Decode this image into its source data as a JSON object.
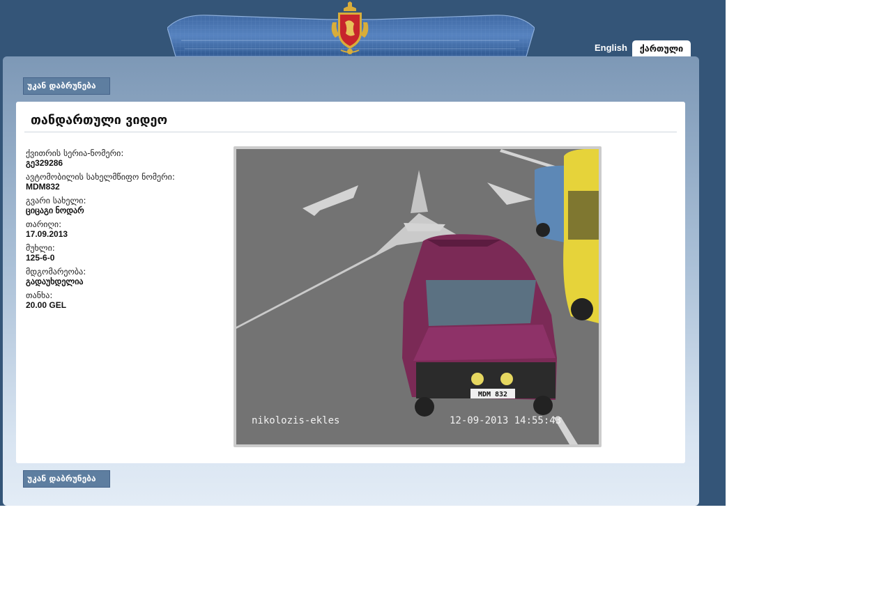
{
  "header": {
    "languages": [
      {
        "label": "English",
        "active": false
      },
      {
        "label": "ქართული",
        "active": true
      }
    ],
    "colors": {
      "background": "#345578",
      "banner": "#4a75b0",
      "emblem_red": "#c7252c",
      "emblem_gold": "#d9ad3a"
    }
  },
  "navigation": {
    "back_label": "უკან დაბრუნება"
  },
  "content": {
    "title": "თანდართული ვიდეო",
    "fields": [
      {
        "label": "ქვითრის სერია-ნომერი:",
        "value": "გე329286"
      },
      {
        "label": "ავტომობილის სახელმწიფო ნომერი:",
        "value": "MDM832"
      },
      {
        "label": "გვარი სახელი:",
        "value": "ციცაგი ნოდარ"
      },
      {
        "label": "თარიღი:",
        "value": "17.09.2013"
      },
      {
        "label": "მუხლი:",
        "value": "125-6-0"
      },
      {
        "label": "მდგომარეობა:",
        "value": "გადაუხდელია"
      },
      {
        "label": "თანხა:",
        "value": "20.00 GEL"
      }
    ]
  },
  "video": {
    "camera_label": "nikolozis-ekles",
    "timestamp": "12-09-2013 14:55:43",
    "plate_text": "MDM 832",
    "vehicle_color": "#7b2a56"
  }
}
